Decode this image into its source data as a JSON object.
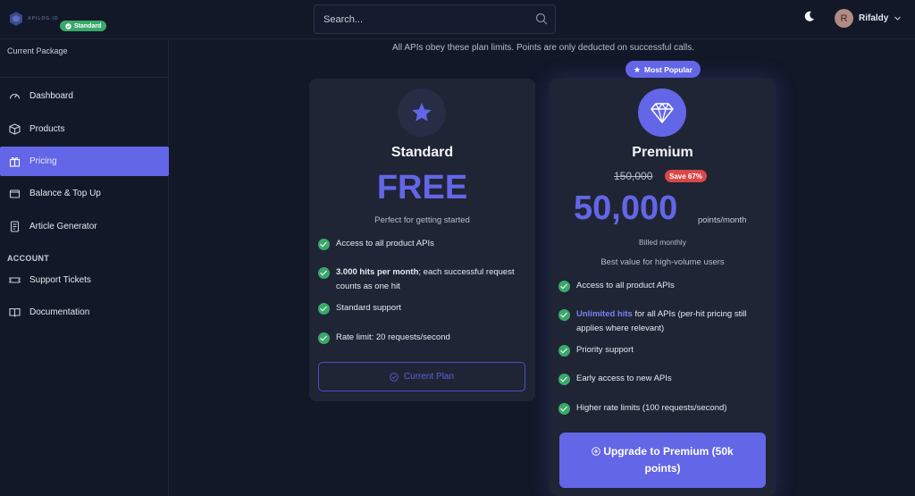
{
  "header": {
    "logo_text": "APILOG.ID",
    "search_placeholder": "Search...",
    "user_initial": "R",
    "user_name": "Rifaldy"
  },
  "sidebar": {
    "package_title": "Current Package",
    "package_badge": "Standard",
    "items": [
      {
        "label": "Dashboard",
        "icon": "gauge-icon"
      },
      {
        "label": "Products",
        "icon": "box-icon"
      },
      {
        "label": "Pricing",
        "icon": "gift-icon",
        "active": true
      },
      {
        "label": "Balance & Top Up",
        "icon": "wallet-icon"
      },
      {
        "label": "Article Generator",
        "icon": "document-icon"
      }
    ],
    "account_section": "ACCOUNT",
    "account_items": [
      {
        "label": "Support Tickets",
        "icon": "ticket-icon"
      },
      {
        "label": "Documentation",
        "icon": "book-icon"
      }
    ]
  },
  "main": {
    "notice": "All APIs obey these plan limits. Points are only deducted on successful calls.",
    "standard": {
      "name": "Standard",
      "price": "FREE",
      "tagline": "Perfect for getting started",
      "features": [
        {
          "text": "Access to all product APIs"
        },
        {
          "bold": "3.000 hits per month",
          "text": "; each successful request counts as one hit"
        },
        {
          "text": "Standard support"
        },
        {
          "text": "Rate limit: 20 requests/second"
        }
      ],
      "button": "Current Plan"
    },
    "premium": {
      "badge": "Most Popular",
      "name": "Premium",
      "old_price": "150,000",
      "save": "Save 67%",
      "price": "50,000",
      "unit": "points/month",
      "billed": "Billed monthly",
      "tagline": "Best value for high-volume users",
      "features": [
        {
          "text": "Access to all product APIs"
        },
        {
          "highlight": "Unlimited hits",
          "text": " for all APIs (per-hit pricing still applies where relevant)"
        },
        {
          "text": "Priority support"
        },
        {
          "text": "Early access to new APIs"
        },
        {
          "text": "Higher rate limits (100 requests/second)"
        }
      ],
      "button": "Upgrade to Premium (50k points)"
    }
  },
  "colors": {
    "background": "#121828",
    "card": "#1f2535",
    "accent": "#6366e6",
    "success": "#3aa86b",
    "danger": "#d94848"
  }
}
